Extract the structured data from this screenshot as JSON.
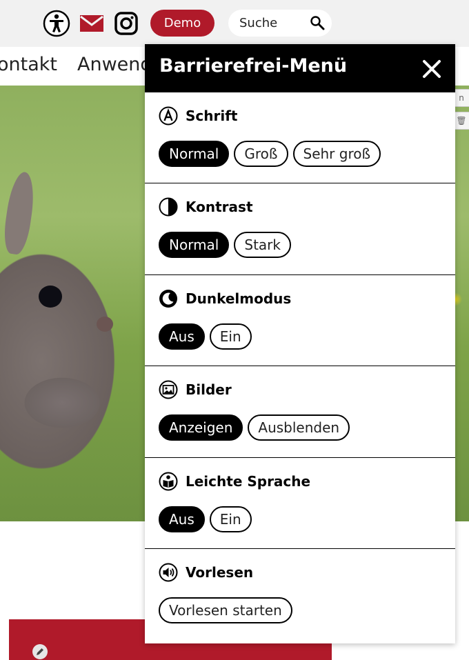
{
  "header": {
    "icons": [
      "accessibility-icon",
      "mail-icon",
      "instagram-icon"
    ],
    "demo_label": "Demo",
    "search_placeholder": "Suche"
  },
  "nav": {
    "items": [
      "ontakt",
      "Anwend"
    ]
  },
  "hero": {
    "chip_labels": [
      "n",
      "🗑"
    ]
  },
  "colors": {
    "brand_red": "#b01a2a",
    "panel_header": "#000000"
  },
  "panel": {
    "title": "Barrierefrei-Menü",
    "sections": [
      {
        "label": "Schrift",
        "icon": "font-size-icon",
        "options": [
          "Normal",
          "Groß",
          "Sehr groß"
        ],
        "selected": "Normal"
      },
      {
        "label": "Kontrast",
        "icon": "contrast-icon",
        "options": [
          "Normal",
          "Stark"
        ],
        "selected": "Normal"
      },
      {
        "label": "Dunkelmodus",
        "icon": "moon-icon",
        "options": [
          "Aus",
          "Ein"
        ],
        "selected": "Aus"
      },
      {
        "label": "Bilder",
        "icon": "image-icon",
        "options": [
          "Anzeigen",
          "Ausblenden"
        ],
        "selected": "Anzeigen"
      },
      {
        "label": "Leichte Sprache",
        "icon": "easy-language-icon",
        "options": [
          "Aus",
          "Ein"
        ],
        "selected": "Aus"
      },
      {
        "label": "Vorlesen",
        "icon": "speaker-icon",
        "options": [
          "Vorlesen starten"
        ],
        "selected": ""
      }
    ]
  }
}
